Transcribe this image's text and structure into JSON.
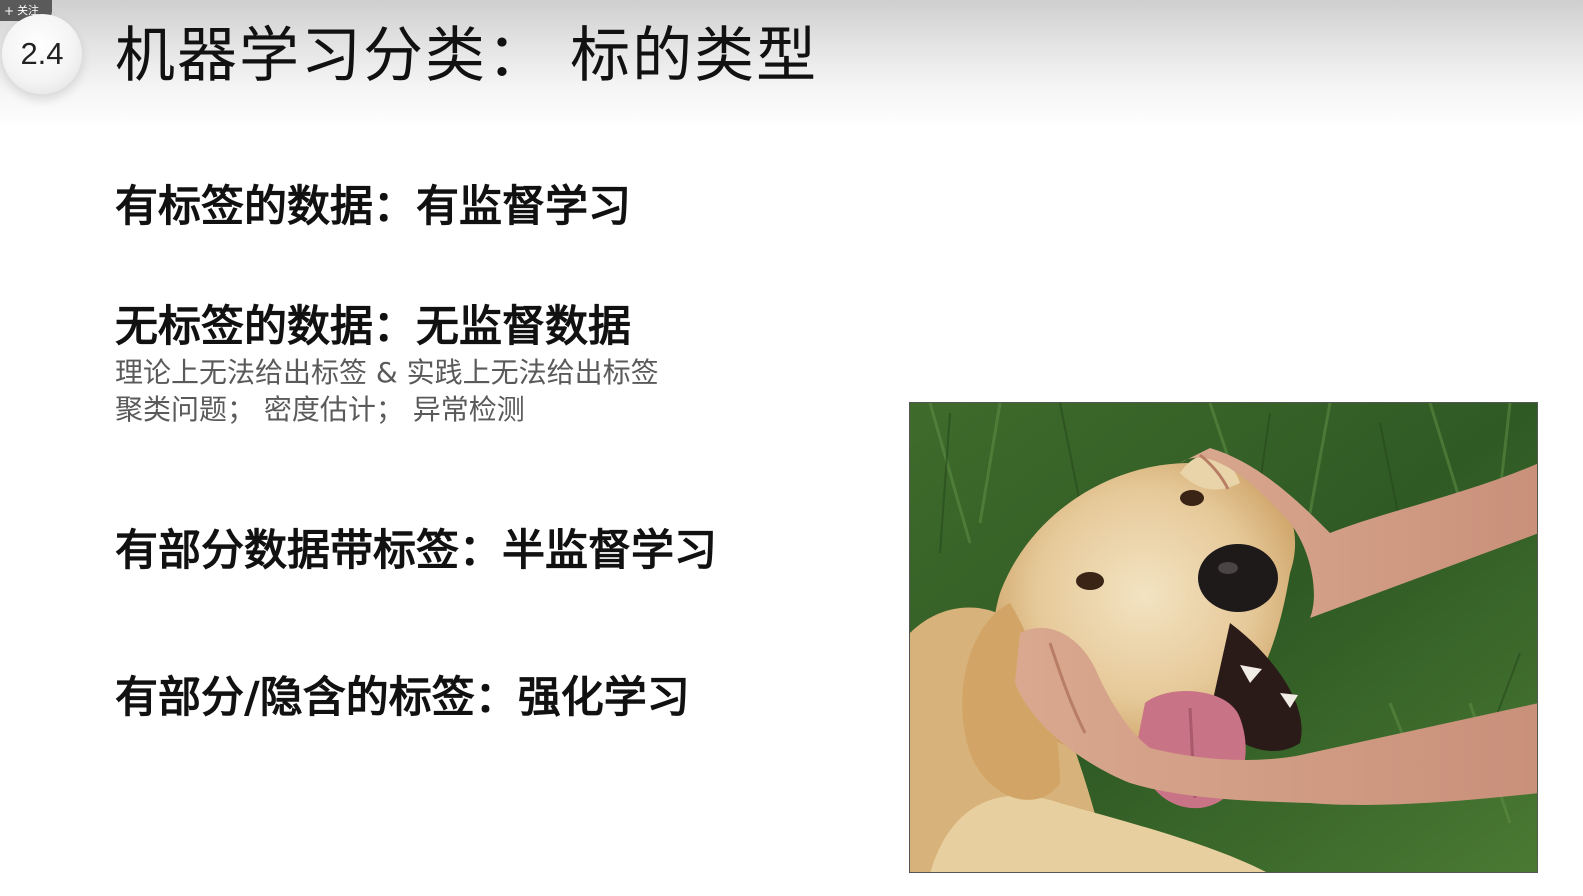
{
  "overlay": {
    "follow_plus": "+",
    "follow_label": "关注"
  },
  "slide": {
    "section_number": "2.4",
    "title": "机器学习分类：  标的类型",
    "items": [
      {
        "heading": "有标签的数据：有监督学习"
      },
      {
        "heading": "无标签的数据：无监督数据",
        "details": [
          "理论上无法给出标签 & 实践上无法给出标签",
          "聚类问题；  密度估计；  异常检测"
        ]
      },
      {
        "heading": "有部分数据带标签：半监督学习"
      },
      {
        "heading": "有部分/隐含的标签：强化学习"
      }
    ],
    "image": {
      "subject": "golden-retriever-with-hands"
    }
  }
}
